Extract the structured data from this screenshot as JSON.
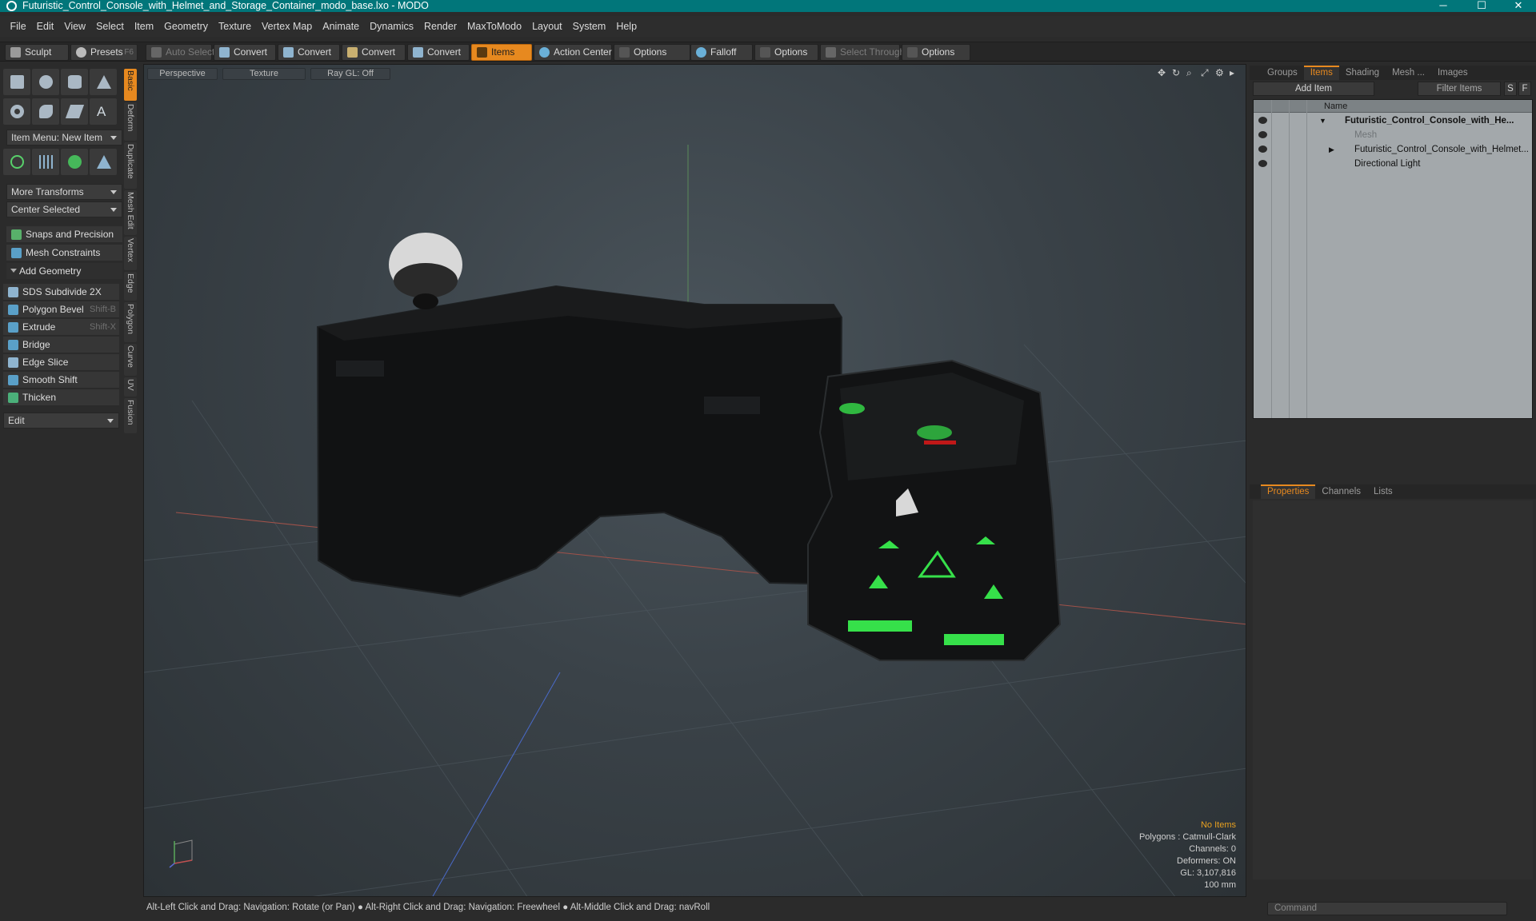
{
  "window": {
    "title": "Futuristic_Control_Console_with_Helmet_and_Storage_Container_modo_base.lxo - MODO",
    "minimize": "─",
    "maximize": "☐",
    "close": "✕"
  },
  "menu": [
    "File",
    "Edit",
    "View",
    "Select",
    "Item",
    "Geometry",
    "Texture",
    "Vertex Map",
    "Animate",
    "Dynamics",
    "Render",
    "MaxToModo",
    "Layout",
    "System",
    "Help"
  ],
  "toolbar": {
    "sculpt": "Sculpt",
    "presets": "Presets",
    "presets_shortcut": "F6",
    "auto_select": "Auto Select",
    "convert1": "Convert",
    "convert2": "Convert",
    "convert3": "Convert",
    "convert4": "Convert",
    "items": "Items",
    "action_center": "Action Center",
    "options1": "Options",
    "falloff": "Falloff",
    "options2": "Options",
    "select_through": "Select Through",
    "options3": "Options"
  },
  "left": {
    "item_menu": "Item Menu: New Item",
    "more_transforms": "More Transforms",
    "center_selected": "Center Selected",
    "snaps": "Snaps and Precision",
    "mesh_constraints": "Mesh Constraints",
    "add_geometry": "Add Geometry",
    "tools": [
      {
        "label": "SDS Subdivide 2X",
        "shortcut": "",
        "color": "#8fb4cf"
      },
      {
        "label": "Polygon Bevel",
        "shortcut": "Shift-B",
        "color": "#5aa0c8"
      },
      {
        "label": "Extrude",
        "shortcut": "Shift-X",
        "color": "#5aa0c8"
      },
      {
        "label": "Bridge",
        "shortcut": "",
        "color": "#5aa0c8"
      },
      {
        "label": "Edge Slice",
        "shortcut": "",
        "color": "#8fb4cf"
      },
      {
        "label": "Smooth Shift",
        "shortcut": "",
        "color": "#5aa0c8"
      },
      {
        "label": "Thicken",
        "shortcut": "",
        "color": "#4bb07a"
      }
    ],
    "edit": "Edit",
    "vtabs": [
      "Basic",
      "Deform",
      "Duplicate",
      "Mesh Edit",
      "Vertex",
      "Edge",
      "Polygon",
      "Curve",
      "UV",
      "Fusion"
    ]
  },
  "viewport": {
    "perspective": "Perspective",
    "texture": "Texture",
    "raygl": "Ray GL: Off",
    "info": {
      "no_items": "No Items",
      "polygons": "Polygons : Catmull-Clark",
      "channels": "Channels: 0",
      "deformers": "Deformers: ON",
      "gl": "GL: 3,107,816",
      "scale": "100 mm"
    }
  },
  "right": {
    "tabs": [
      "Groups",
      "Items",
      "Shading",
      "Mesh ...",
      "Images"
    ],
    "add_item": "Add Item",
    "filter_items": "Filter Items",
    "s": "S",
    "f": "F",
    "name_col": "Name",
    "tree": [
      {
        "label": "Futuristic_Control_Console_with_He...",
        "bold": true
      },
      {
        "label": "Mesh",
        "dim": true
      },
      {
        "label": "Futuristic_Control_Console_with_Helmet..."
      },
      {
        "label": "Directional Light"
      }
    ],
    "prop_tabs": [
      "Properties",
      "Channels",
      "Lists"
    ],
    "command": "Command"
  },
  "status": "Alt-Left Click and Drag: Navigation: Rotate (or Pan) ● Alt-Right Click and Drag: Navigation: Freewheel ● Alt-Middle Click and Drag: navRoll",
  "colors": {
    "accent": "#e7891f",
    "title": "#01767a",
    "glow": "#36e04a",
    "warn": "#e7a020"
  }
}
